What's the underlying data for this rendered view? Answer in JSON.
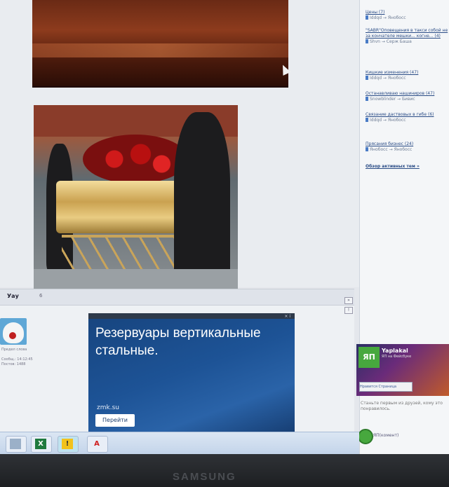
{
  "post": {
    "author": "Уау",
    "count": "6",
    "avatar_caption": "Предел слова",
    "meta_line_1": "Сообщ.: 14:12:45",
    "meta_line_2": "Постов: 1488"
  },
  "ad": {
    "headline": "Резервуары вертикальные стальные.",
    "domain": "zmk.su",
    "button_label": "Перейти",
    "close_label": "× i"
  },
  "sidebar": {
    "threads": [
      {
        "title": "Цены (7)",
        "meta": "Iddqd → Янобосс"
      },
      {
        "title": "\"SABR\"Оповещения в такси собой не за кончателе мешки... когне... (4)",
        "meta": "Shvn → Серж Баша"
      },
      {
        "title": "Кишкие изменения (47)",
        "meta": "Iddqd → Янобосс"
      },
      {
        "title": "Останавливаю нашиниров (47)",
        "meta": "Snowblinder → Бивис"
      },
      {
        "title": "Связание даствовых в гибе (6)",
        "meta": "Iddqd → Янобосс"
      },
      {
        "title": "Прясания бизнес (24)",
        "meta": "Янобосс → Янобосс"
      }
    ],
    "all_link": "Обзор активных тем »"
  },
  "fb_widget": {
    "logo": "ЯП",
    "title": "Yaplakal",
    "subtitle": "ЯП на Фейсбуке",
    "like_label": "Нравится Страница",
    "caption": "Станьте первым из друзей, кому это понравилось.",
    "comment_label": "ЯП(комент)"
  },
  "taskbar": {
    "apps": [
      {
        "name": "explorer",
        "glyph": ""
      },
      {
        "name": "excel",
        "glyph": "X"
      },
      {
        "name": "warning",
        "glyph": "!"
      },
      {
        "name": "acrobat",
        "glyph": "A"
      }
    ]
  },
  "monitor": {
    "brand": "SAMSUNG"
  },
  "colors": {
    "ad_blue": "#1d5396",
    "link_blue": "#2a4c86",
    "taskbar": "#c3d4ea"
  }
}
